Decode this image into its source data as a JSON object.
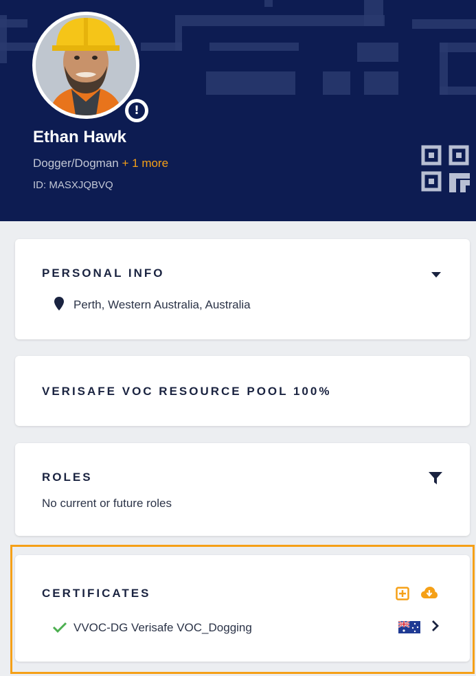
{
  "profile": {
    "name": "Ethan Hawk",
    "role": "Dogger/Dogman",
    "more_roles": "+ 1 more",
    "id_label": "ID: MASXJQBVQ",
    "alert_symbol": "!"
  },
  "personal_info": {
    "title": "PERSONAL INFO",
    "location": "Perth, Western Australia, Australia"
  },
  "resource_pool": {
    "title": "VERISAFE VOC RESOURCE POOL 100%"
  },
  "roles": {
    "title": "ROLES",
    "empty_text": "No current or future roles"
  },
  "certificates": {
    "title": "CERTIFICATES",
    "items": [
      {
        "label": "VVOC-DG Verisafe VOC_Dogging",
        "country_flag": "australia-flag-icon",
        "status": "valid-check-icon"
      }
    ]
  },
  "colors": {
    "header_bg": "#0d1c52",
    "accent": "#f5a017",
    "success": "#4caf50",
    "page_bg": "#eceef1"
  }
}
